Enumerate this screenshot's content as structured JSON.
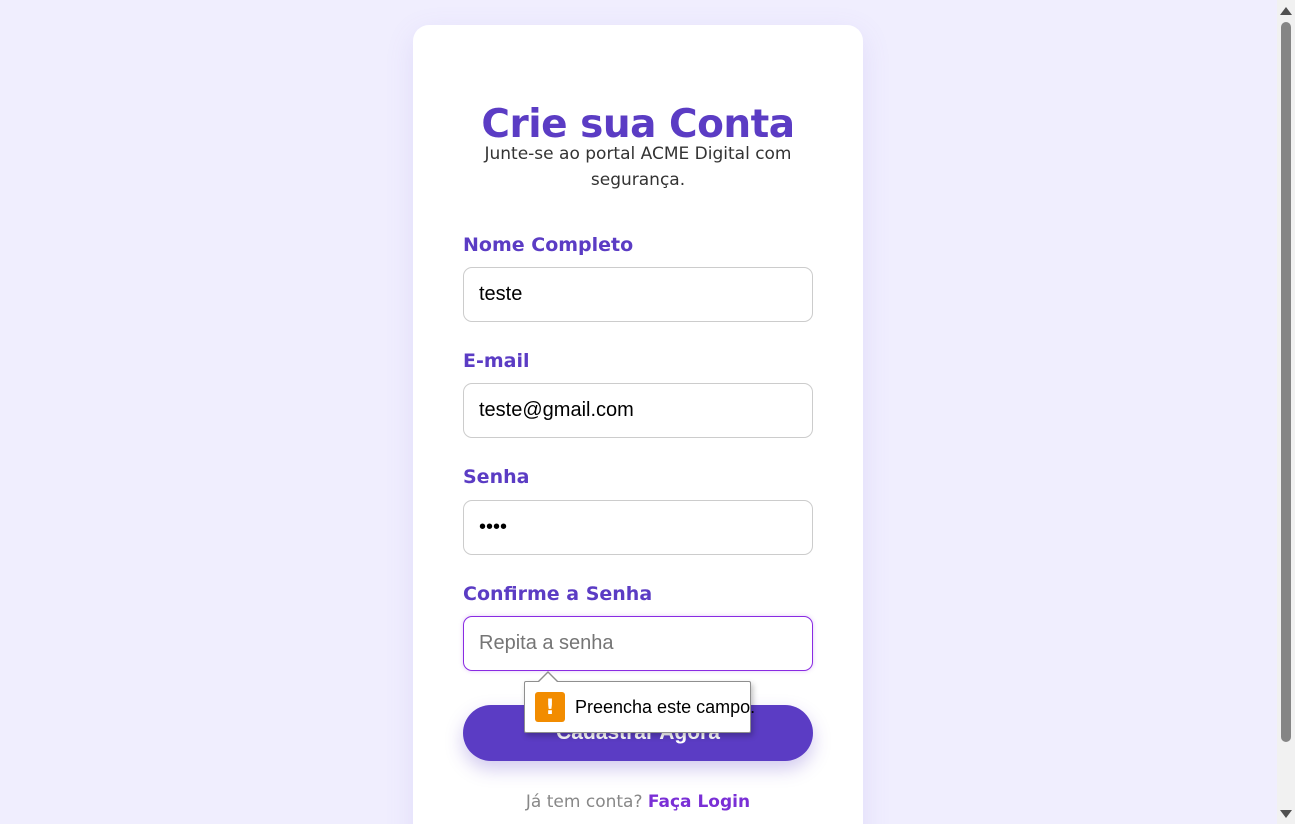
{
  "form": {
    "title": "Crie sua Conta",
    "subtitle": "Junte-se ao portal ACME Digital com segurança.",
    "fields": {
      "name": {
        "label": "Nome Completo",
        "value": "teste",
        "placeholder": ""
      },
      "email": {
        "label": "E-mail",
        "value": "teste@gmail.com",
        "placeholder": ""
      },
      "password": {
        "label": "Senha",
        "value": "••••",
        "placeholder": ""
      },
      "confirm": {
        "label": "Confirme a Senha",
        "value": "",
        "placeholder": "Repita a senha"
      }
    },
    "submit_label": "Cadastrar Agora",
    "footer_text": "Já tem conta?",
    "login_link": "Faça Login"
  },
  "validation_tooltip": {
    "icon": "warning-icon",
    "icon_glyph": "!",
    "message": "Preencha este campo."
  },
  "colors": {
    "background": "#f0eefe",
    "accent": "#5b3cc4",
    "link": "#7a2fd6",
    "warning": "#f28c00"
  }
}
